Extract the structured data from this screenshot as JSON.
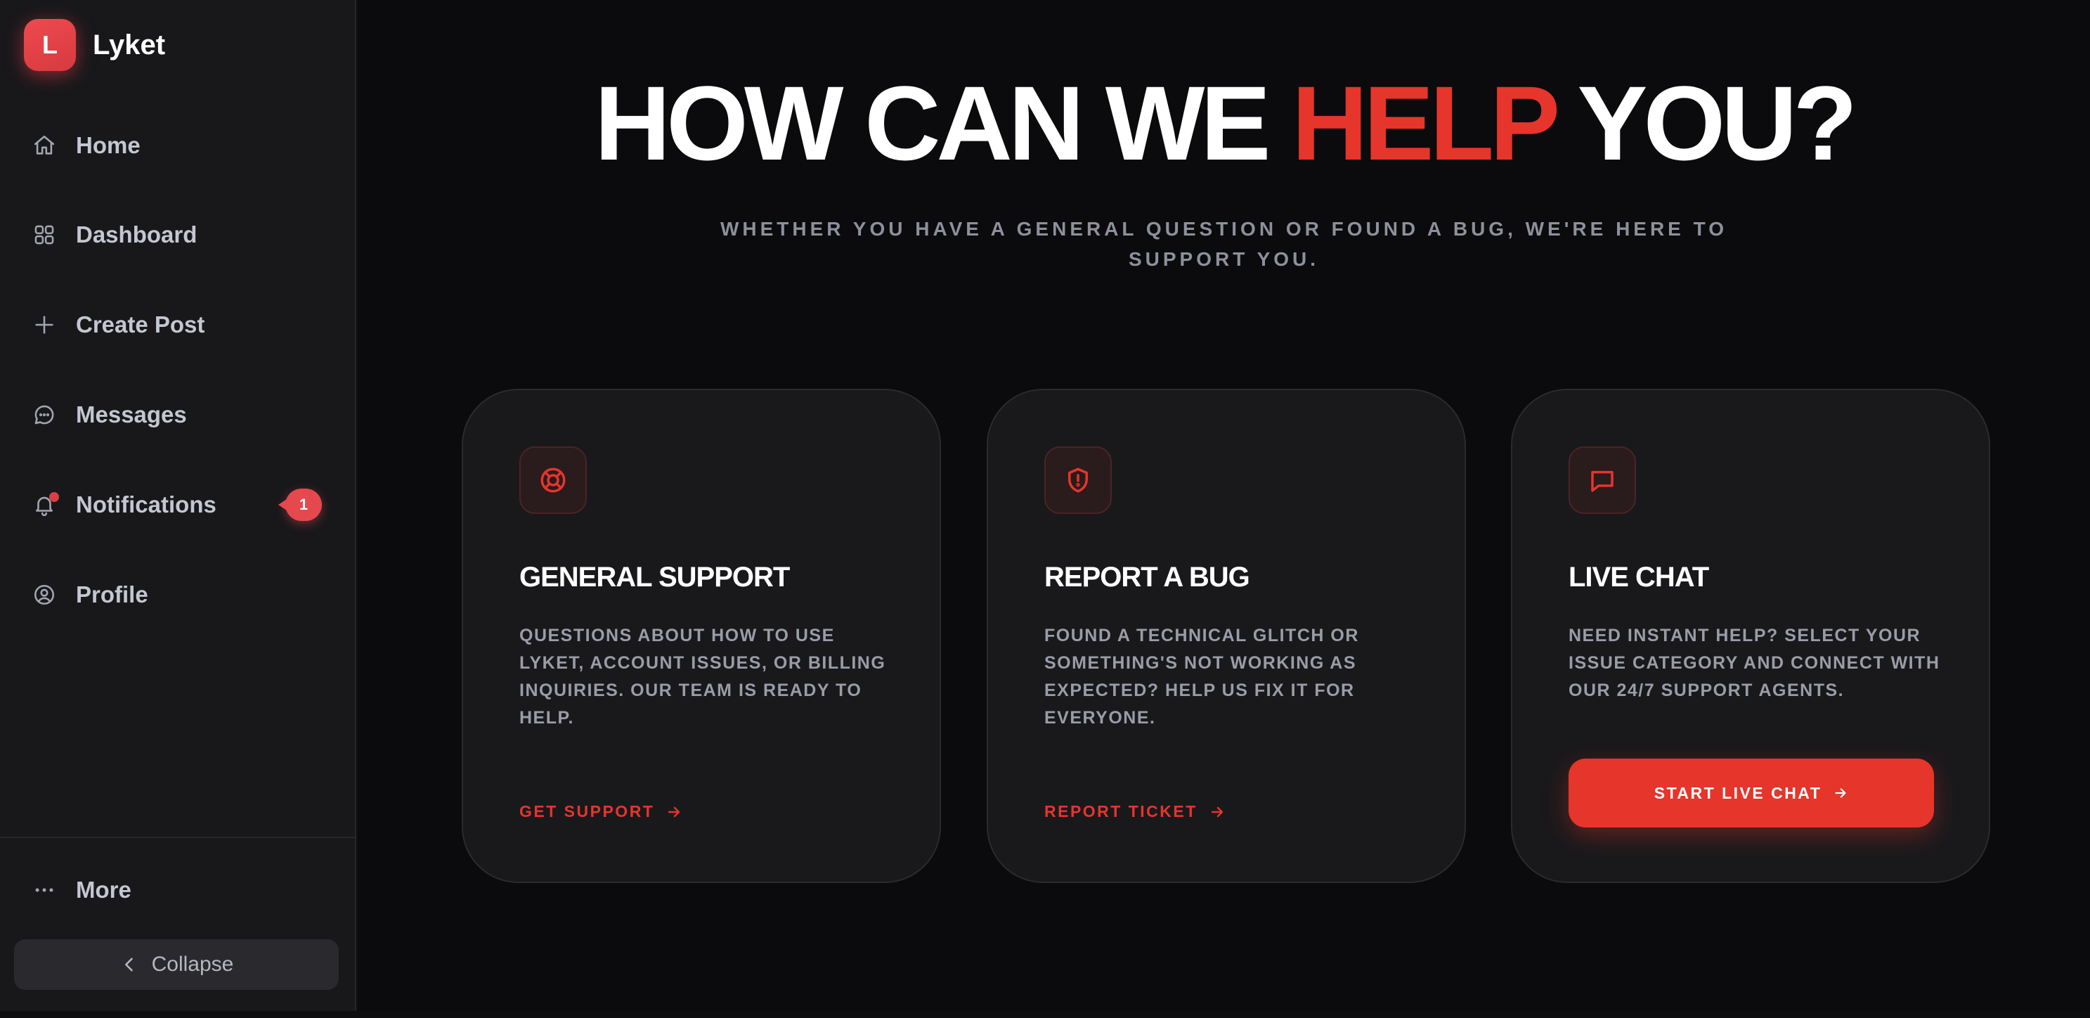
{
  "brand": {
    "logo_letter": "L",
    "name": "Lyket"
  },
  "sidebar": {
    "items": [
      {
        "label": "Home",
        "icon": "home-icon"
      },
      {
        "label": "Dashboard",
        "icon": "grid-icon"
      },
      {
        "label": "Create Post",
        "icon": "plus-icon"
      },
      {
        "label": "Messages",
        "icon": "chat-bubble-icon"
      },
      {
        "label": "Notifications",
        "icon": "bell-icon",
        "badge": "1"
      },
      {
        "label": "Profile",
        "icon": "user-circle-icon"
      }
    ],
    "more_label": "More",
    "more_icon": "ellipsis-icon",
    "collapse_label": "Collapse",
    "collapse_icon": "chevron-left-icon"
  },
  "hero": {
    "title_prefix": "HOW CAN WE",
    "title_accent": "HELP",
    "title_suffix": "YOU?",
    "subtitle": "WHETHER YOU HAVE A GENERAL QUESTION OR FOUND A BUG, WE'RE HERE TO SUPPORT YOU."
  },
  "cards": [
    {
      "icon": "lifebuoy-icon",
      "title": "GENERAL SUPPORT",
      "description": "QUESTIONS ABOUT HOW TO USE LYKET, ACCOUNT ISSUES, OR BILLING INQUIRIES. OUR TEAM IS READY TO HELP.",
      "action_label": "GET SUPPORT"
    },
    {
      "icon": "shield-alert-icon",
      "title": "REPORT A BUG",
      "description": "FOUND A TECHNICAL GLITCH OR SOMETHING'S NOT WORKING AS EXPECTED? HELP US FIX IT FOR EVERYONE.",
      "action_label": "REPORT TICKET"
    },
    {
      "icon": "message-square-icon",
      "title": "LIVE CHAT",
      "description": "NEED INSTANT HELP? SELECT YOUR ISSUE CATEGORY AND CONNECT WITH OUR 24/7 SUPPORT AGENTS.",
      "action_label": "START LIVE CHAT"
    }
  ],
  "colors": {
    "accent": "#e6352b",
    "brand_logo": "#e5484d",
    "background": "#0b0b0d",
    "sidebar": "#18181b",
    "card": "#19191c"
  }
}
